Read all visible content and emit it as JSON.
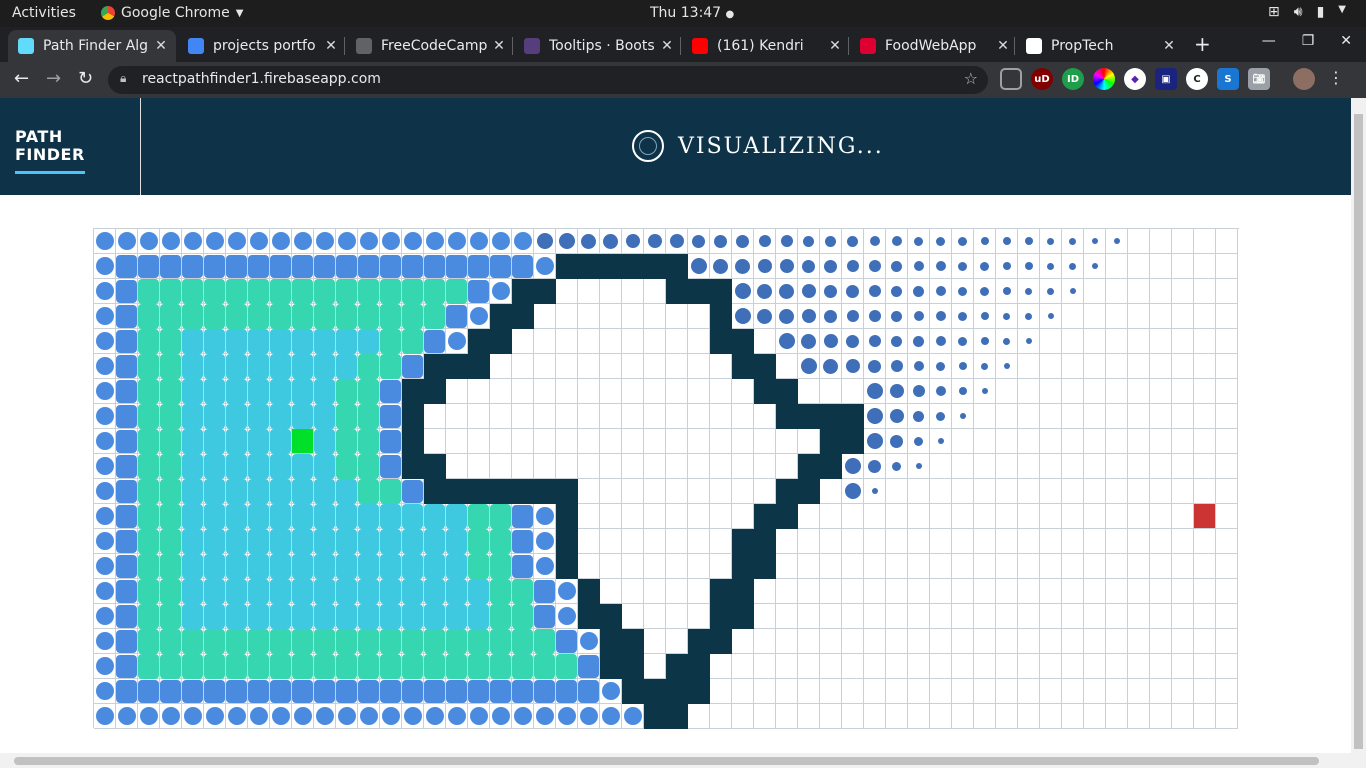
{
  "system_bar": {
    "activities": "Activities",
    "app_name": "Google Chrome",
    "clock": "Thu 13:47"
  },
  "browser": {
    "tabs": [
      {
        "title": "Path Finder Alg",
        "favicon": "react-icon",
        "color": "#61dafb",
        "active": true
      },
      {
        "title": "projects portfo",
        "favicon": "google-icon",
        "color": "#4285f4",
        "active": false
      },
      {
        "title": "FreeCodeCamp",
        "favicon": "freecodecamp-icon",
        "color": "#5f6368",
        "active": false
      },
      {
        "title": "Tooltips · Boots",
        "favicon": "bootstrap-icon",
        "color": "#563d7c",
        "active": false
      },
      {
        "title": "(161) Kendri",
        "favicon": "youtube-icon",
        "color": "#ff0000",
        "active": false
      },
      {
        "title": "FoodWebApp",
        "favicon": "angular-icon",
        "color": "#dd0031",
        "active": false
      },
      {
        "title": "PropTech",
        "favicon": "proptech-icon",
        "color": "#ffffff",
        "active": false
      }
    ],
    "url": "reactpathfinder1.firebaseapp.com"
  },
  "app": {
    "brand_line1": "PATH",
    "brand_line2": "FINDER",
    "status_label": "VISUALIZING..."
  },
  "grid": {
    "columns": 52,
    "rows": 20,
    "start": [
      9,
      8
    ],
    "finish": [
      50,
      11
    ],
    "colors": {
      "wall": "#0c3547",
      "start": "#00e02a",
      "finish": "#cc3333",
      "visited_recent": "#3f6fb8",
      "visited_mid": "#4a8be0",
      "visited_old": "#35d6b0",
      "visited_oldest": "#3ec9e0"
    }
  }
}
